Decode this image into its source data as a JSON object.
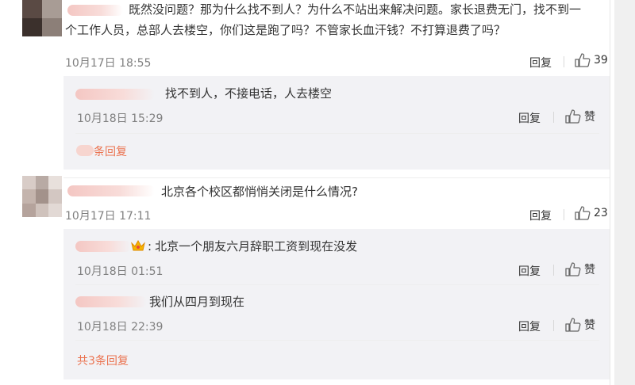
{
  "comments": [
    {
      "text": "既然没问题？那为什么找不到人？为什么不站出来解决问题。家长退费无门，找不到一个工作人员，总部人去楼空，你们这是跑了吗？不管家长血汗钱？不打算退费了吗？",
      "line1": "既然没问题？那为什么找不到人？为什么不站出来解决问题。家长退费无门，找不到一",
      "line2": "个工作人员，总部人去楼空，你们这是跑了吗？不管家长血汗钱？不打算退费了吗？",
      "time": "10月17日 18:55",
      "reply_label": "回复",
      "likes": "39",
      "replies": [
        {
          "text": "找不到人，不接电话，人去楼空",
          "time": "10月18日 15:29",
          "reply_label": "回复",
          "like_label": "赞"
        }
      ],
      "more_replies": "条回复"
    },
    {
      "text": "北京各个校区都悄悄关闭是什么情况?",
      "time": "10月17日 17:11",
      "reply_label": "回复",
      "likes": "23",
      "replies": [
        {
          "text": "北京一个朋友六月辞职工资到现在没发",
          "prefix": ":",
          "time": "10月18日 01:51",
          "reply_label": "回复",
          "like_label": "赞"
        },
        {
          "text": "我们从四月到现在",
          "time": "10月18日 22:39",
          "reply_label": "回复",
          "like_label": "赞"
        }
      ],
      "more_replies": "共3条回复"
    }
  ],
  "colors": {
    "accent": "#eb7350",
    "reply_bg": "#f2f2f5",
    "meta": "#808080"
  },
  "icons": {
    "like": "thumbs-up-icon",
    "crown": "crown-icon"
  }
}
